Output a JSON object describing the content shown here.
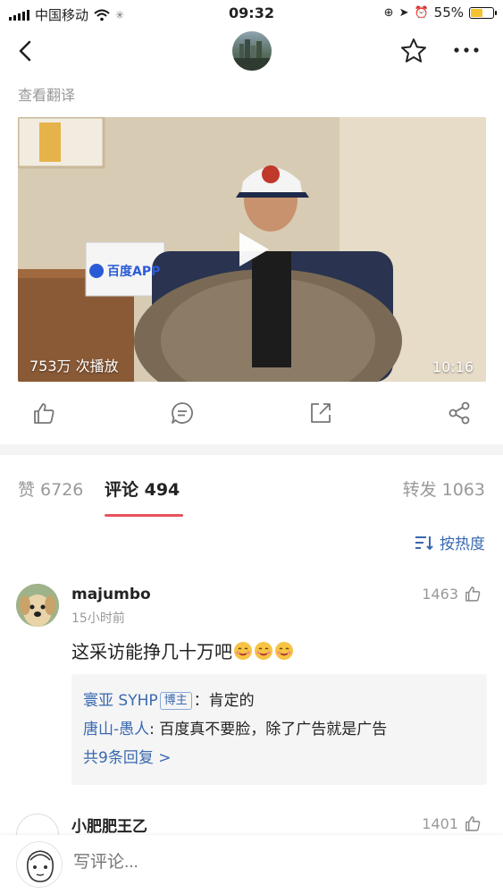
{
  "status_bar": {
    "carrier": "中国移动",
    "time": "09:32",
    "battery": "55%",
    "battery_level": 0.55
  },
  "nav": {
    "back_icon": "chevron-left-icon",
    "avatar_icon": "city-skyline-avatar",
    "favorite_icon": "star-outline-icon",
    "more_icon": "more-dots-icon"
  },
  "post": {
    "translate_label": "查看翻译"
  },
  "video": {
    "views": "753万 次播放",
    "duration": "10:16",
    "logo_text": "百度APP",
    "play_icon": "play-icon"
  },
  "actions": [
    {
      "icon": "thumbs-up-icon"
    },
    {
      "icon": "comment-bubble-icon"
    },
    {
      "icon": "share-edit-icon"
    },
    {
      "icon": "share-nodes-icon"
    }
  ],
  "tabs": {
    "likes": "赞 6726",
    "comments": "评论 494",
    "reposts": "转发 1063"
  },
  "sort": {
    "label": "按热度",
    "icon": "sort-lines-icon"
  },
  "comments": [
    {
      "name": "majumbo",
      "time": "15小时前",
      "likes": "1463",
      "text": "这采访能挣几十万吧",
      "emoji": [
        "drooling-face-emoji",
        "drooling-face-emoji",
        "drooling-face-emoji"
      ],
      "replies": [
        {
          "name": "寰亚 SYHP",
          "badge": "博主",
          "text": "：肯定的"
        },
        {
          "name": "唐山-愚人",
          "text": ": 百度真不要脸，除了广告就是广告"
        }
      ],
      "more_replies": "共9条回复 >"
    },
    {
      "name": "小肥肥王乙",
      "likes": "1401"
    }
  ],
  "bottom": {
    "placeholder": "写评论..."
  }
}
